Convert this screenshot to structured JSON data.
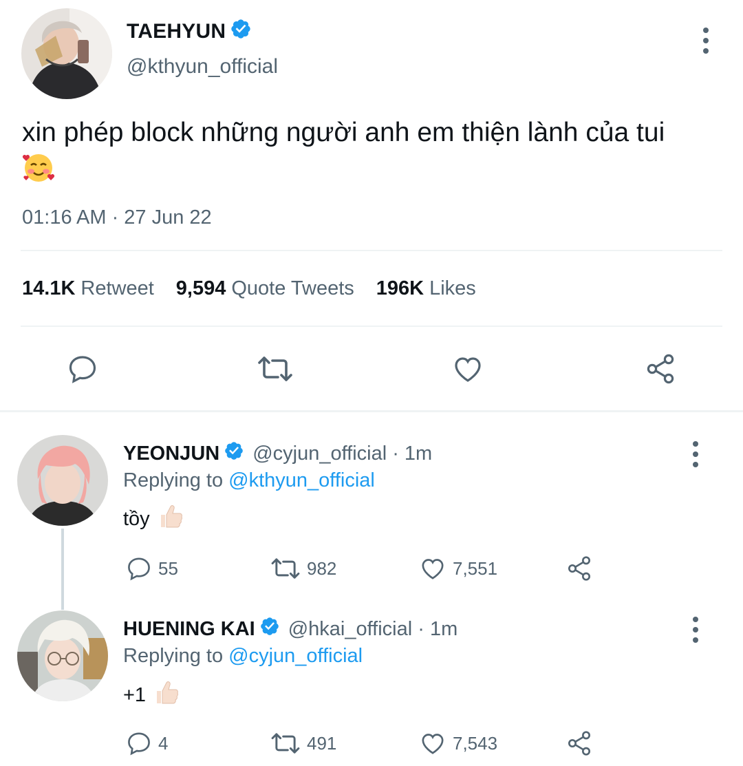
{
  "main_tweet": {
    "name": "TAEHYUN",
    "handle": "@kthyun_official",
    "text": "xin phép block những người anh em thiện lành của tui",
    "emoji": "smiling-face-with-hearts",
    "timestamp": "01:16 AM · 27 Jun 22",
    "stats": [
      {
        "count": "14.1K",
        "label": "Retweet"
      },
      {
        "count": "9,594",
        "label": "Quote Tweets"
      },
      {
        "count": "196K",
        "label": "Likes"
      }
    ]
  },
  "replies": [
    {
      "name": "YEONJUN",
      "handle": "@cyjun_official · 1m",
      "replying_prefix": "Replying to",
      "replying_to": "@kthyun_official",
      "text": "tồy",
      "emoji": "thumbs-up",
      "replies": "55",
      "retweets": "982",
      "likes": "7,551"
    },
    {
      "name": "HUENING KAI",
      "handle": "@hkai_official · 1m",
      "replying_prefix": "Replying to",
      "replying_to": "@cyjun_official",
      "text": "+1",
      "emoji": "thumbs-up",
      "replies": "4",
      "retweets": "491",
      "likes": "7,543"
    }
  ],
  "colors": {
    "verified": "#1d9bf0",
    "secondary_text": "#536471",
    "link": "#1d9bf0",
    "divider": "#eff3f4"
  }
}
